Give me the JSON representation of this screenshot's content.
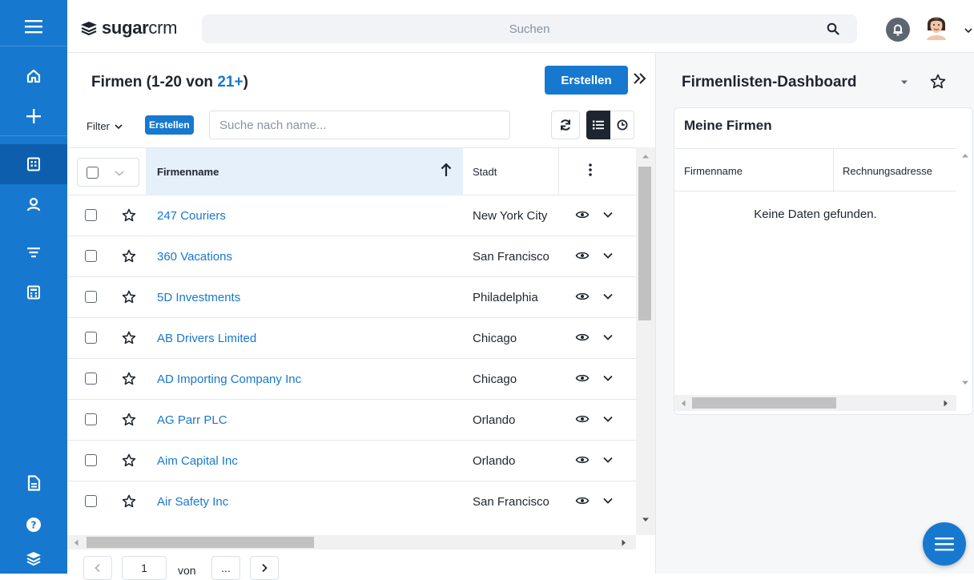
{
  "colors": {
    "brand": "#1778cf",
    "nav_active": "#0d5fae",
    "text": "#1f2530",
    "link": "#1778cf"
  },
  "leftnav": {
    "items": [
      {
        "icon": "menu-icon"
      },
      {
        "icon": "home-icon"
      },
      {
        "icon": "plus-icon"
      },
      {
        "icon": "accounts-icon",
        "active": true
      },
      {
        "icon": "contacts-icon"
      },
      {
        "icon": "filter-icon"
      },
      {
        "icon": "calculator-icon"
      },
      {
        "icon": "document-icon"
      },
      {
        "icon": "help-icon"
      },
      {
        "icon": "sugar-layers-icon"
      }
    ]
  },
  "topbar": {
    "brand_bold": "sugar",
    "brand_light": "crm",
    "search_placeholder": "Suchen"
  },
  "list": {
    "title_prefix": "Firmen (1-20 von ",
    "title_count": "21+",
    "title_suffix": ")",
    "create_label": "Erstellen",
    "filter_label": "Filter",
    "filter_create_label": "Erstellen",
    "name_search_placeholder": "Suche nach name...",
    "columns": {
      "name": "Firmenname",
      "city": "Stadt"
    },
    "rows": [
      {
        "name": "247 Couriers",
        "city": "New York City"
      },
      {
        "name": "360 Vacations",
        "city": "San Francisco"
      },
      {
        "name": "5D Investments",
        "city": "Philadelphia"
      },
      {
        "name": "AB Drivers Limited",
        "city": "Chicago"
      },
      {
        "name": "AD Importing Company Inc",
        "city": "Chicago"
      },
      {
        "name": "AG Parr PLC",
        "city": "Orlando"
      },
      {
        "name": "Aim Capital Inc",
        "city": "Orlando"
      },
      {
        "name": "Air Safety Inc",
        "city": "San Francisco"
      }
    ]
  },
  "pager": {
    "page": "1",
    "von": "von",
    "total": "..."
  },
  "dashboard": {
    "title": "Firmenlisten-Dashboard",
    "dashlet": {
      "title": "Meine Firmen",
      "col1": "Firmenname",
      "col2": "Rechnungsadresse",
      "empty": "Keine Daten gefunden."
    }
  }
}
